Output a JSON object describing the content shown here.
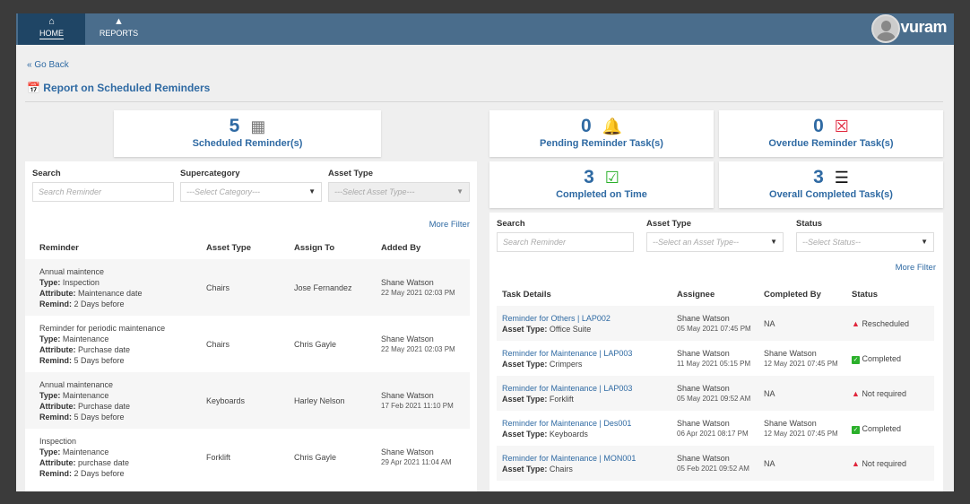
{
  "nav": {
    "tabs": [
      {
        "label": "HOME",
        "icon": "home-icon"
      },
      {
        "label": "REPORTS",
        "icon": "chart-icon"
      }
    ],
    "logo": "vuram"
  },
  "go_back": "Go Back",
  "page_title": "Report on Scheduled Reminders",
  "cards": {
    "scheduled": {
      "count": "5",
      "label": "Scheduled Reminder(s)"
    },
    "pending": {
      "count": "0",
      "label": "Pending Reminder Task(s)"
    },
    "overdue": {
      "count": "0",
      "label": "Overdue Reminder Task(s)"
    },
    "completed_on_time": {
      "count": "3",
      "label": "Completed on Time"
    },
    "overall_completed": {
      "count": "3",
      "label": "Overall Completed Task(s)"
    }
  },
  "colors": {
    "header": "#4a6d8c",
    "accent": "#2f6aa3",
    "danger": "#e0243b",
    "success": "#2bb02b"
  },
  "left": {
    "filters": {
      "search_label": "Search",
      "search_placeholder": "Search Reminder",
      "supercategory_label": "Supercategory",
      "supercategory_value": "---Select Category---",
      "asset_type_label": "Asset Type",
      "asset_type_value": "---Select Asset Type---"
    },
    "more_filter": "More Filter",
    "columns": [
      "Reminder",
      "Asset Type",
      "Assign To",
      "Added By"
    ],
    "rows": [
      {
        "name": "Annual maintence",
        "type": "Inspection",
        "attribute": "Maintenance date",
        "remind": "2 Days before",
        "asset_type": "Chairs",
        "assign_to": "Jose Fernandez",
        "added_by": "Shane Watson",
        "added_on": "22 May 2021 02:03 PM"
      },
      {
        "name": "Reminder for periodic maintenance",
        "type": "Maintenance",
        "attribute": "Purchase date",
        "remind": "5 Days before",
        "asset_type": "Chairs",
        "assign_to": "Chris Gayle",
        "added_by": "Shane Watson",
        "added_on": "22 May 2021 02:03 PM"
      },
      {
        "name": "Annual maintenance",
        "type": "Maintenance",
        "attribute": "Purchase date",
        "remind": "5 Days before",
        "asset_type": "Keyboards",
        "assign_to": "Harley Nelson",
        "added_by": "Shane Watson",
        "added_on": "17 Feb 2021 11:10 PM"
      },
      {
        "name": "Inspection",
        "type": "Maintenance",
        "attribute": "purchase date",
        "remind": "2 Days before",
        "asset_type": "Forklift",
        "assign_to": "Chris Gayle",
        "added_by": "Shane Watson",
        "added_on": "29 Apr 2021 11:04 AM"
      }
    ],
    "labels": {
      "type": "Type:",
      "attribute": "Attribute:",
      "remind": "Remind:"
    }
  },
  "right": {
    "filters": {
      "search_label": "Search",
      "search_placeholder": "Search Reminder",
      "asset_type_label": "Asset Type",
      "asset_type_value": "--Select an Asset Type--",
      "status_label": "Status",
      "status_value": "--Select Status--"
    },
    "more_filter": "More Filter",
    "columns": [
      "Task Details",
      "Assignee",
      "Completed By",
      "Status"
    ],
    "asset_type_label": "Asset Type:",
    "rows": [
      {
        "task": "Reminder for Others | LAP002",
        "asset_type": "Office Suite",
        "assignee": "Shane Watson",
        "assigned_on": "05 May 2021 07:45 PM",
        "completed_by": "NA",
        "completed_on": "",
        "status": "Rescheduled",
        "status_kind": "warn"
      },
      {
        "task": "Reminder for Maintenance | LAP003",
        "asset_type": "Crimpers",
        "assignee": "Shane Watson",
        "assigned_on": "11 May 2021 05:15 PM",
        "completed_by": "Shane Watson",
        "completed_on": "12 May 2021 07:45 PM",
        "status": "Completed",
        "status_kind": "ok"
      },
      {
        "task": "Reminder for Maintenance | LAP003",
        "asset_type": "Forklift",
        "assignee": "Shane Watson",
        "assigned_on": "05 May 2021 09:52 AM",
        "completed_by": "NA",
        "completed_on": "",
        "status": "Not required",
        "status_kind": "warn"
      },
      {
        "task": "Reminder for Maintenance | Des001",
        "asset_type": "Keyboards",
        "assignee": "Shane Watson",
        "assigned_on": "06 Apr 2021 08:17 PM",
        "completed_by": "Shane Watson",
        "completed_on": "12 May 2021 07:45 PM",
        "status": "Completed",
        "status_kind": "ok"
      },
      {
        "task": "Reminder for Maintenance | MON001",
        "asset_type": "Chairs",
        "assignee": "Shane Watson",
        "assigned_on": "05 Feb 2021 09:52 AM",
        "completed_by": "NA",
        "completed_on": "",
        "status": "Not required",
        "status_kind": "warn"
      }
    ]
  }
}
